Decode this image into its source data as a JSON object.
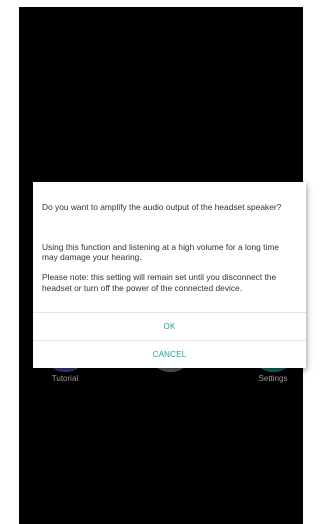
{
  "dialog": {
    "title_line": "Do you want to amplify the audio output of the headset speaker?",
    "warning": "Using this function and listening at a high volume for a long time may damage your hearing.",
    "note": " Please note: this setting will remain set until you disconnect the headset or turn off the power of the connected device.",
    "ok_label": "OK",
    "cancel_label": "CANCEL"
  },
  "launcher": {
    "tutorial_label": "Tutorial",
    "tutorial_glyph": "?",
    "settings_label": "Settings"
  },
  "colors": {
    "accent": "#1aa597",
    "screen_background": "#000000",
    "tutorial_icon": "#3a3f8c",
    "apps_icon": "#5d5d5d",
    "settings_icon": "#0f6f66"
  },
  "icons": {
    "tutorial": "question-mark-icon",
    "apps": "app-drawer-dots-icon",
    "settings": "gear-icon"
  }
}
